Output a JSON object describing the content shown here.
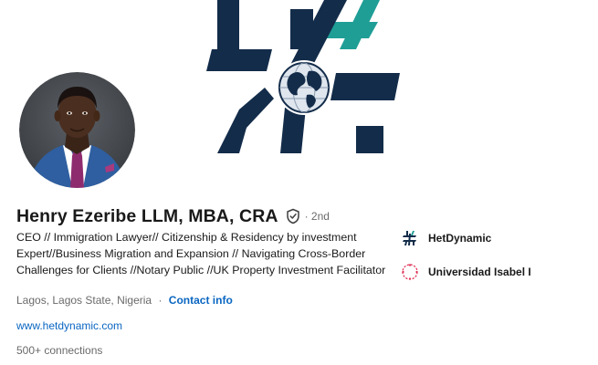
{
  "profile": {
    "name": "Henry Ezeribe  LLM, MBA, CRA",
    "degree": "· 2nd",
    "headline": "CEO //  Immigration Lawyer// Citizenship & Residency by investment Expert//Business Migration and Expansion // Navigating Cross-Border Challenges for Clients //Notary Public //UK Property Investment Facilitator",
    "location": "Lagos, Lagos State, Nigeria",
    "separator": "·",
    "contact_label": "Contact info",
    "website": "www.hetdynamic.com",
    "connections": "500+ connections"
  },
  "organizations": [
    {
      "name": "HetDynamic",
      "icon": "hetdynamic-logo-icon"
    },
    {
      "name": "Universidad Isabel I",
      "icon": "universidad-logo-icon"
    }
  ],
  "colors": {
    "link_blue": "#0a66c2",
    "banner_navy": "#132c4a",
    "banner_teal": "#1f9e96",
    "avatar_bg": "#4a4d52",
    "university_red": "#e0284f"
  },
  "icons": {
    "verified": "verified-shield-icon",
    "banner_globe": "globe-icon"
  }
}
